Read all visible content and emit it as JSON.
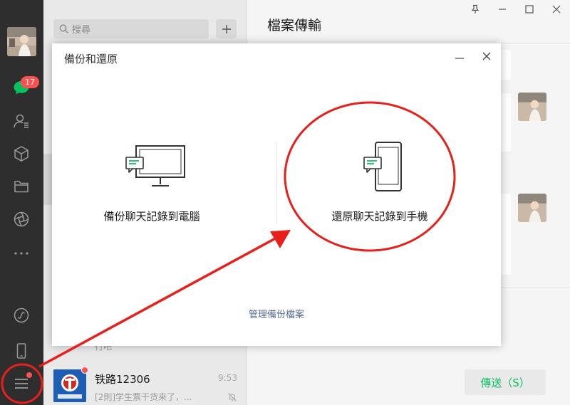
{
  "sidebar": {
    "unread_badge": "17",
    "icons": [
      "chat-icon",
      "contacts-icon",
      "collections-icon",
      "files-icon",
      "moments-icon",
      "more-icon",
      "mini-program-icon",
      "phone-icon",
      "menu-icon"
    ]
  },
  "session_list": {
    "search_placeholder": "搜尋",
    "partial_text": "行吧",
    "items": [
      {
        "name": "铁路12306",
        "time": "9:53",
        "preview": "[2則]学生票干货来了，..."
      }
    ]
  },
  "chat": {
    "title": "檔案傳輸",
    "send_label": "傳送（S）"
  },
  "modal": {
    "title": "備份和還原",
    "backup_label": "備份聊天記錄到電腦",
    "restore_label": "還原聊天記錄到手機",
    "manage_link": "管理備份檔案"
  },
  "colors": {
    "accent_green": "#07c160",
    "badge_red": "#fa5151",
    "annotation_red": "#e8201c",
    "link_blue": "#576b95"
  }
}
